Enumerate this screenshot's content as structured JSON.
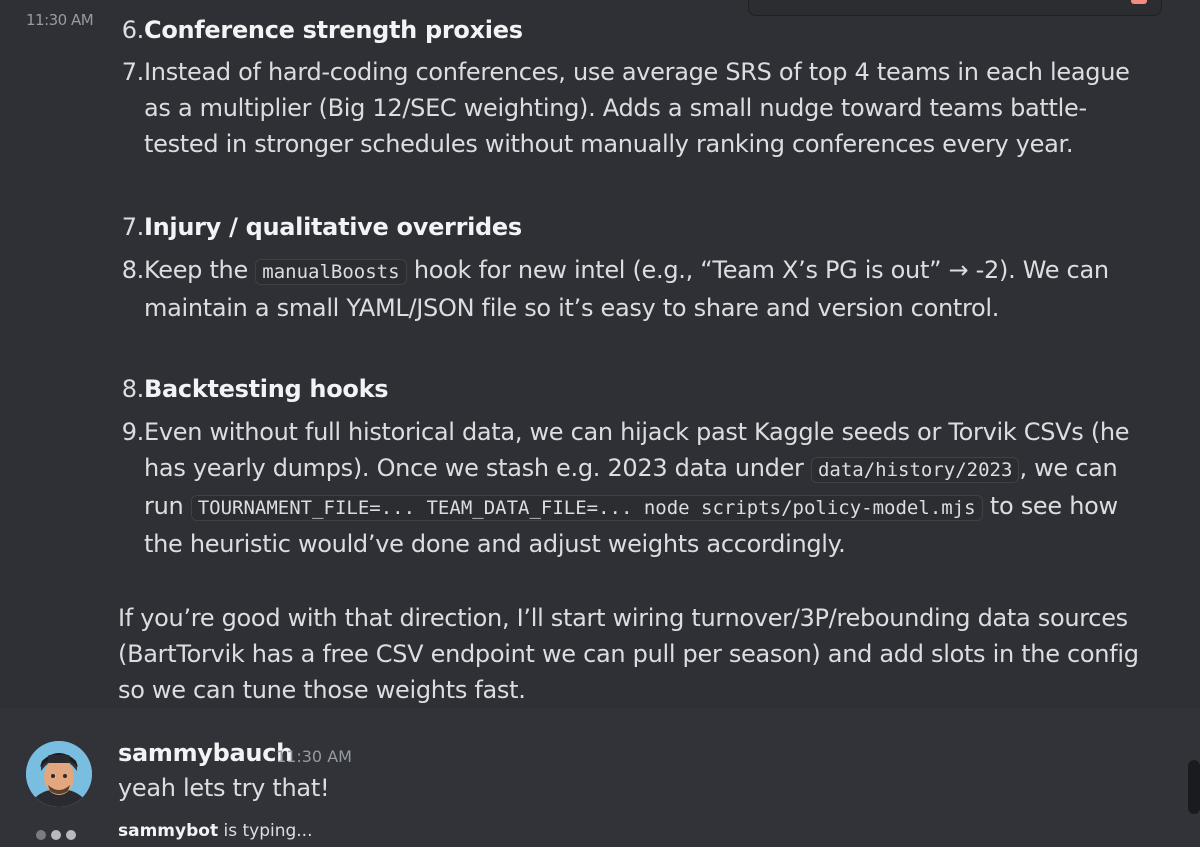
{
  "message1": {
    "timestamp": "11:30 AM",
    "items": [
      {
        "num": "6.",
        "title": "Conference strength proxies"
      },
      {
        "num": "7.",
        "text": "Instead of hard-coding conferences, use average SRS of top 4 teams in each league as a multiplier (Big 12/SEC weighting). Adds a small nudge toward teams battle-tested in stronger schedules without manually ranking conferences every year."
      },
      {
        "num": "7.",
        "title": "Injury / qualitative overrides"
      },
      {
        "num": "8.",
        "text_before": "Keep the ",
        "code": "manualBoosts",
        "text_after": " hook for new intel (e.g., “Team X’s PG is out” → -2). We can maintain a small YAML/JSON file so it’s easy to share and version control."
      },
      {
        "num": "8.",
        "title": "Backtesting hooks"
      },
      {
        "num": "9.",
        "text_a": "Even without full historical data, we can hijack past Kaggle seeds or Torvik CSVs (he has yearly dumps). Once we stash e.g. 2023 data under ",
        "code_a": "data/history/2023",
        "text_b": ", we can run ",
        "code_b": "TOURNAMENT_FILE=... TEAM_DATA_FILE=... node scripts/policy-model.mjs",
        "text_c": " to see how the heuristic would’ve done and adjust weights accordingly."
      }
    ],
    "closing": "If you’re good with that direction, I’ll start wiring turnover/3P/rebounding data sources (BartTorvik has a free CSV endpoint we can pull per season) and add slots in the config so we can tune those weights fast."
  },
  "message2": {
    "author": "sammybauch",
    "timestamp": "11:30 AM",
    "text": "yeah lets try that!"
  },
  "typing": {
    "user": "sammybot",
    "suffix": " is typing..."
  }
}
